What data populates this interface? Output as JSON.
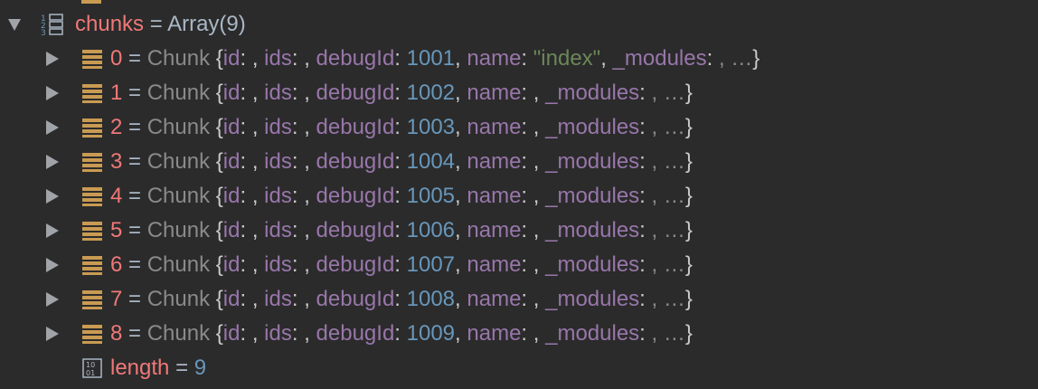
{
  "colors": {
    "background": "#2b2b2b",
    "variable_name": "#f07878",
    "property_key": "#9876aa",
    "number": "#6897bb",
    "string": "#6a8759",
    "type_name": "#8a8a8a",
    "object_icon": "#c99b52"
  },
  "icons": {
    "expand_open": "triangle-down-icon",
    "expand_closed": "triangle-right-icon",
    "array": "array-icon",
    "object": "object-icon",
    "primitive": "primitive-icon"
  },
  "variable": {
    "name": "chunks",
    "equals": "=",
    "value": "Array(9)"
  },
  "chunk_common": {
    "equals": "=",
    "type": "Chunk",
    "open": "{",
    "id_key": "id",
    "ids_key": "ids",
    "debug_key": "debugId",
    "name_key": "name",
    "modules_key": "_modules",
    "colon": ":",
    "sep": ",",
    "ellipsis": ", …",
    "close": "}"
  },
  "chunks": [
    {
      "index": "0",
      "debugId": "1001",
      "name": "\"index\""
    },
    {
      "index": "1",
      "debugId": "1002",
      "name": ""
    },
    {
      "index": "2",
      "debugId": "1003",
      "name": ""
    },
    {
      "index": "3",
      "debugId": "1004",
      "name": ""
    },
    {
      "index": "4",
      "debugId": "1005",
      "name": ""
    },
    {
      "index": "5",
      "debugId": "1006",
      "name": ""
    },
    {
      "index": "6",
      "debugId": "1007",
      "name": ""
    },
    {
      "index": "7",
      "debugId": "1008",
      "name": ""
    },
    {
      "index": "8",
      "debugId": "1009",
      "name": ""
    }
  ],
  "length_row": {
    "name": "length",
    "equals": "=",
    "value": "9"
  }
}
